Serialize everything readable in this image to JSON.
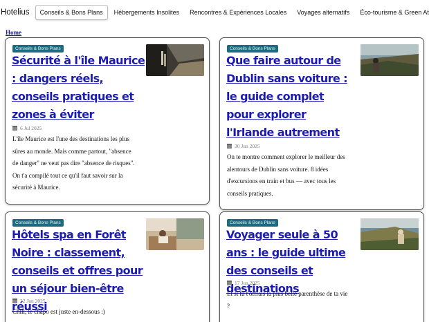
{
  "nav": {
    "brand": "Hotelius",
    "items": [
      {
        "label": "Conseils & Bons Plans"
      },
      {
        "label": "Hébergements Insolites"
      },
      {
        "label": "Rencontres & Expériences Locales"
      },
      {
        "label": "Voyages alternatifs"
      },
      {
        "label": "Éco-tourisme & Green Attitude"
      }
    ]
  },
  "breadcrumb": "Home",
  "cards": [
    {
      "badge": "Conseils & Bons Plans",
      "title": "Sécurité à l'île Maurice : dangers réels, conseils pratiques et zones à éviter",
      "date": "6 Jul 2025",
      "excerpt": "L'île Maurice est l'une des destinations les plus sûres au monde. Mais comme partout, \"absence de danger\" ne veut pas dire \"absence de risques\". On t'a compilé tout ce qu'il faut savoir sur la sécurité à Maurice."
    },
    {
      "badge": "Conseils & Bons Plans",
      "title": "Que faire autour de Dublin sans voiture : le guide complet pour explorer l'Irlande autrement",
      "date": "30 Jun 2025",
      "excerpt": "On te montre comment explorer le meilleur des alentours de Dublin sans voiture. 8 idées d'excursions en train et bus — avec tous les conseils pratiques."
    },
    {
      "badge": "Conseils & Bons Plans",
      "title": "Hôtels spa en Forêt Noire : classement, conseils et offres pour un séjour bien-être réussi",
      "date": "22 Jun 2025",
      "excerpt": "Chill, le chapo est juste en-dessous :)"
    },
    {
      "badge": "Conseils & Bons Plans",
      "title": "Voyager seule à 50 ans : le guide ultime des conseils et destinations",
      "date": "17 Jun 2025",
      "excerpt": "Et si tu t'offrais la plus belle parenthèse de ta vie ?"
    }
  ]
}
